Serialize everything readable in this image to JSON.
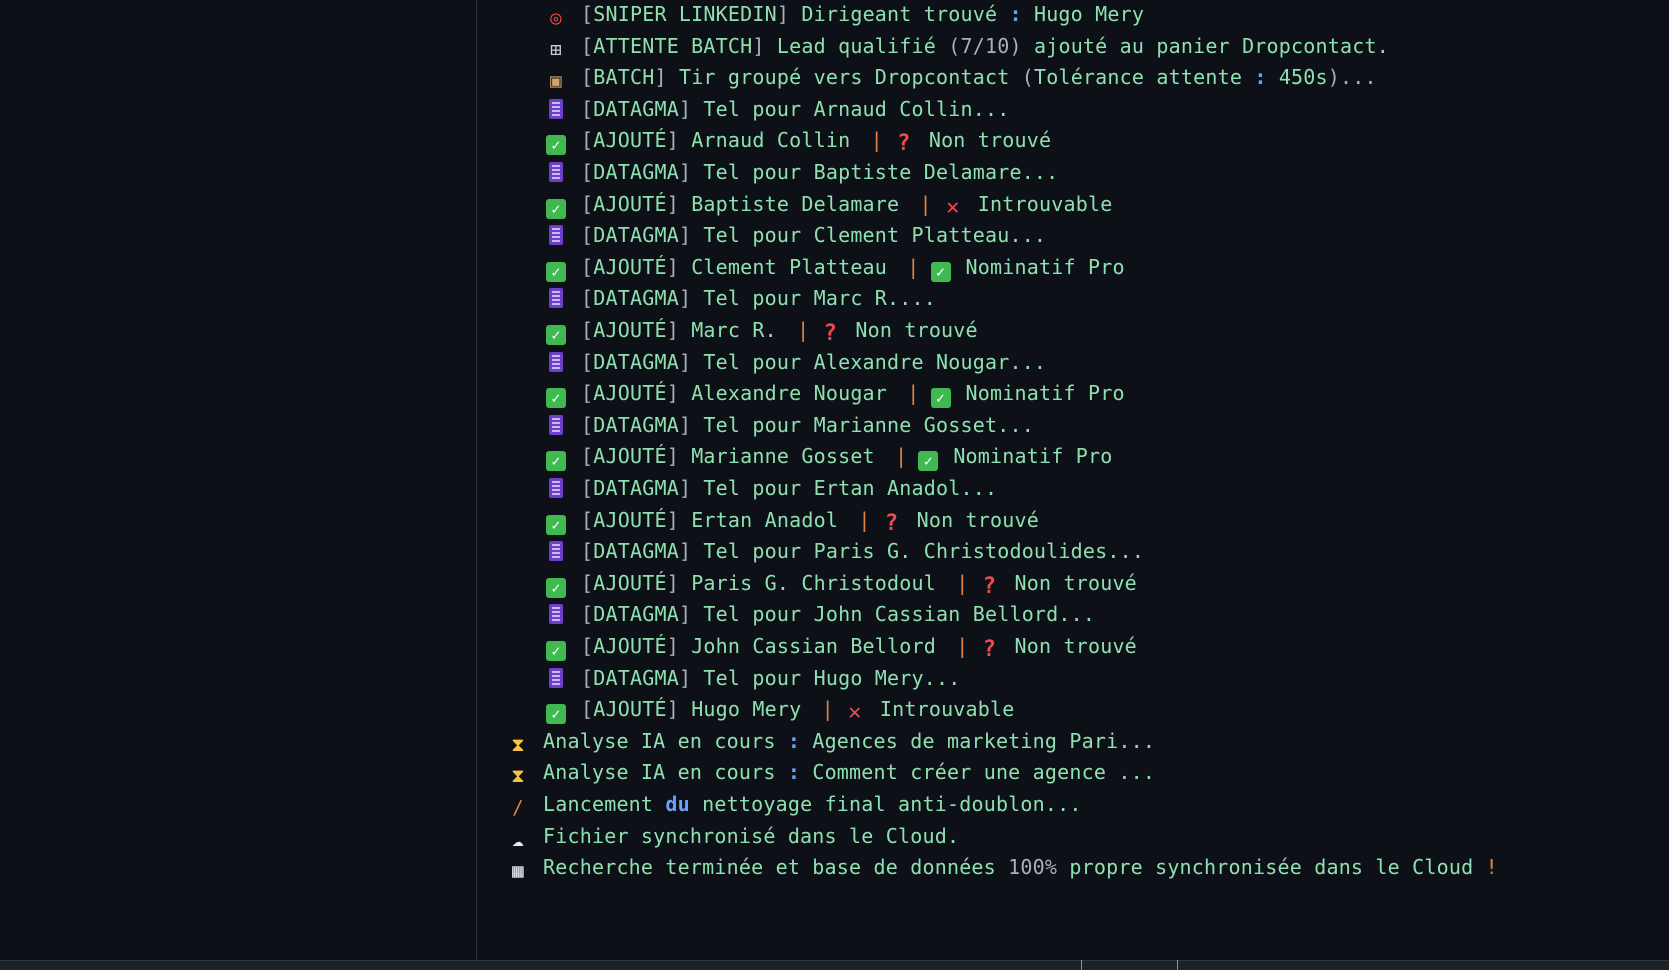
{
  "log_lines": [
    {
      "indent": "sub",
      "icon": "target-icon",
      "tag": "SNIPER LINKEDIN",
      "text": "Dirigeant trouvé",
      "colon_after": true,
      "tail": "Hugo Mery"
    },
    {
      "indent": "sub",
      "icon": "cart-icon",
      "tag": "ATTENTE BATCH",
      "text": "Lead qualifié",
      "paren": "(7/10)",
      "tail": "ajouté au panier Dropcontact."
    },
    {
      "indent": "sub",
      "icon": "package-icon",
      "tag": "BATCH",
      "text": "Tir groupé vers Dropcontact",
      "paren_open": "(",
      "text2": "Tolérance attente",
      "colon_after2": true,
      "tail": "450s",
      "paren_close": ")...",
      "tail2": ""
    },
    {
      "indent": "sub",
      "icon": "abacus-icon",
      "tag": "DATAGMA",
      "text": "Tel pour Arnaud Collin..."
    },
    {
      "indent": "sub",
      "icon": "check-icon",
      "tag": "AJOUTÉ",
      "name": "Arnaud Collin",
      "status_icon": "question-icon",
      "status": "Non trouvé"
    },
    {
      "indent": "sub",
      "icon": "abacus-icon",
      "tag": "DATAGMA",
      "text": "Tel pour Baptiste Delamare..."
    },
    {
      "indent": "sub",
      "icon": "check-icon",
      "tag": "AJOUTÉ",
      "name": "Baptiste Delamare",
      "status_icon": "cross-icon",
      "status": "Introuvable"
    },
    {
      "indent": "sub",
      "icon": "abacus-icon",
      "tag": "DATAGMA",
      "text": "Tel pour Clement Platteau..."
    },
    {
      "indent": "sub",
      "icon": "check-icon",
      "tag": "AJOUTÉ",
      "name": "Clement Platteau",
      "status_icon": "check-icon",
      "status": "Nominatif Pro"
    },
    {
      "indent": "sub",
      "icon": "abacus-icon",
      "tag": "DATAGMA",
      "text": "Tel pour Marc R...."
    },
    {
      "indent": "sub",
      "icon": "check-icon",
      "tag": "AJOUTÉ",
      "name": "Marc R.",
      "status_icon": "question-icon",
      "status": "Non trouvé"
    },
    {
      "indent": "sub",
      "icon": "abacus-icon",
      "tag": "DATAGMA",
      "text": "Tel pour Alexandre Nougar..."
    },
    {
      "indent": "sub",
      "icon": "check-icon",
      "tag": "AJOUTÉ",
      "name": "Alexandre Nougar",
      "status_icon": "check-icon",
      "status": "Nominatif Pro"
    },
    {
      "indent": "sub",
      "icon": "abacus-icon",
      "tag": "DATAGMA",
      "text": "Tel pour Marianne Gosset..."
    },
    {
      "indent": "sub",
      "icon": "check-icon",
      "tag": "AJOUTÉ",
      "name": "Marianne Gosset",
      "status_icon": "check-icon",
      "status": "Nominatif Pro"
    },
    {
      "indent": "sub",
      "icon": "abacus-icon",
      "tag": "DATAGMA",
      "text": "Tel pour Ertan Anadol..."
    },
    {
      "indent": "sub",
      "icon": "check-icon",
      "tag": "AJOUTÉ",
      "name": "Ertan Anadol",
      "status_icon": "question-icon",
      "status": "Non trouvé"
    },
    {
      "indent": "sub",
      "icon": "abacus-icon",
      "tag": "DATAGMA",
      "text": "Tel pour Paris G. Christodoulides..."
    },
    {
      "indent": "sub",
      "icon": "check-icon",
      "tag": "AJOUTÉ",
      "name": "Paris G. Christodoul",
      "status_icon": "question-icon",
      "status": "Non trouvé"
    },
    {
      "indent": "sub",
      "icon": "abacus-icon",
      "tag": "DATAGMA",
      "text": "Tel pour John Cassian Bellord..."
    },
    {
      "indent": "sub",
      "icon": "check-icon",
      "tag": "AJOUTÉ",
      "name": "John Cassian Bellord",
      "status_icon": "question-icon",
      "status": "Non trouvé"
    },
    {
      "indent": "sub",
      "icon": "abacus-icon",
      "tag": "DATAGMA",
      "text": "Tel pour Hugo Mery..."
    },
    {
      "indent": "sub",
      "icon": "check-icon",
      "tag": "AJOUTÉ",
      "name": "Hugo Mery",
      "status_icon": "cross-icon",
      "status": "Introuvable"
    },
    {
      "indent": "top",
      "icon": "hourglass-icon",
      "text": "Analyse IA en cours",
      "colon_after": true,
      "tail": "Agences de marketing Pari..."
    },
    {
      "indent": "top",
      "icon": "hourglass-icon",
      "text": "Analyse IA en cours",
      "colon_after": true,
      "tail": "Comment créer une agence ..."
    },
    {
      "indent": "top",
      "icon": "broom-icon",
      "text": "Lancement",
      "blue_word": "du",
      "tail": "nettoyage final anti-doublon..."
    },
    {
      "indent": "top",
      "icon": "cloud-icon",
      "text": "Fichier synchronisé dans le Cloud."
    },
    {
      "indent": "top",
      "icon": "checkered-flag-icon",
      "text": "Recherche terminée et base de données",
      "dim": "100%",
      "tail": "propre synchronisée dans le Cloud",
      "excl": "!"
    }
  ],
  "colors": {
    "background": "#0d1117",
    "text": "#8fe0b0",
    "accent_blue": "#6aa1ff",
    "accent_orange": "#e0823f",
    "success": "#3fb950",
    "error": "#f0484f"
  }
}
